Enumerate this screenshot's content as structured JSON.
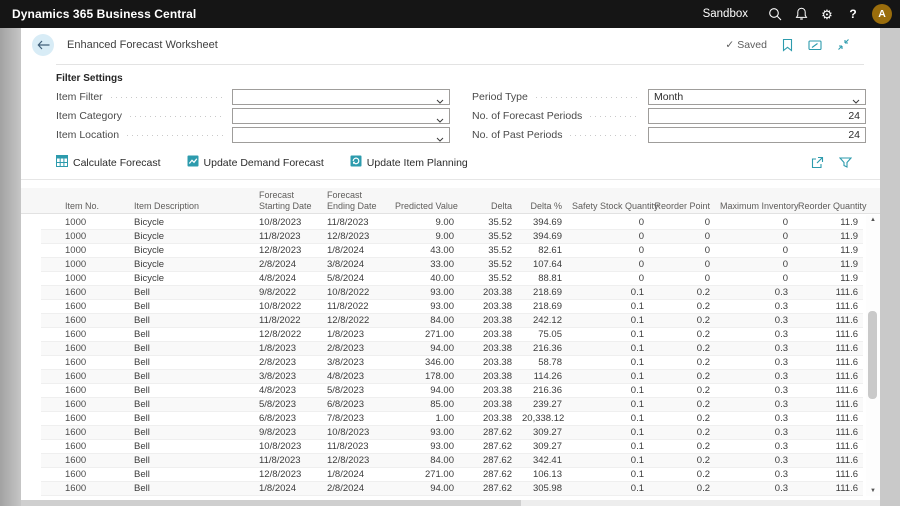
{
  "topbar": {
    "app_title": "Dynamics 365 Business Central",
    "environment": "Sandbox",
    "help_label": "?",
    "avatar_initial": "A",
    "icons": [
      "search-icon",
      "alerts-bell-icon",
      "settings-gear-icon",
      "help-icon"
    ]
  },
  "page": {
    "title": "Enhanced Forecast Worksheet",
    "saved_check": "✓",
    "saved_label": "Saved",
    "header_icons": [
      "bookmark-icon",
      "designer-icon",
      "collapse-page-icon"
    ]
  },
  "filters": {
    "section_title": "Filter Settings",
    "left": [
      {
        "label": "Item Filter",
        "value": "",
        "type": "select"
      },
      {
        "label": "Item Category",
        "value": "",
        "type": "select"
      },
      {
        "label": "Item Location",
        "value": "",
        "type": "select"
      }
    ],
    "right": [
      {
        "label": "Period Type",
        "value": "Month",
        "type": "select"
      },
      {
        "label": "No. of Forecast Periods",
        "value": "24",
        "type": "number"
      },
      {
        "label": "No. of Past Periods",
        "value": "24",
        "type": "number"
      }
    ]
  },
  "actions": {
    "buttons": [
      {
        "label": "Calculate Forecast",
        "icon": "calculate-forecast-icon"
      },
      {
        "label": "Update Demand Forecast",
        "icon": "update-demand-forecast-icon"
      },
      {
        "label": "Update Item Planning",
        "icon": "update-item-planning-icon"
      }
    ],
    "right_icons": [
      "share-icon",
      "filter-icon"
    ]
  },
  "table": {
    "columns": [
      {
        "label": "Item No.",
        "align": "left"
      },
      {
        "label": "Item Description",
        "align": "left"
      },
      {
        "label": "Forecast Starting Date",
        "align": "left"
      },
      {
        "label": "Forecast Ending Date",
        "align": "left"
      },
      {
        "label": "Predicted Value",
        "align": "right"
      },
      {
        "label": "Delta",
        "align": "right"
      },
      {
        "label": "Delta %",
        "align": "right"
      },
      {
        "label": "Safety Stock Quantity",
        "align": "right"
      },
      {
        "label": "Reorder Point",
        "align": "right"
      },
      {
        "label": "Maximum Inventory",
        "align": "right"
      },
      {
        "label": "Reorder Quantity",
        "align": "right"
      }
    ],
    "rows": [
      [
        "1000",
        "Bicycle",
        "10/8/2023",
        "11/8/2023",
        "9.00",
        "35.52",
        "394.69",
        "0",
        "0",
        "0",
        "11.9"
      ],
      [
        "1000",
        "Bicycle",
        "11/8/2023",
        "12/8/2023",
        "9.00",
        "35.52",
        "394.69",
        "0",
        "0",
        "0",
        "11.9"
      ],
      [
        "1000",
        "Bicycle",
        "12/8/2023",
        "1/8/2024",
        "43.00",
        "35.52",
        "82.61",
        "0",
        "0",
        "0",
        "11.9"
      ],
      [
        "1000",
        "Bicycle",
        "2/8/2024",
        "3/8/2024",
        "33.00",
        "35.52",
        "107.64",
        "0",
        "0",
        "0",
        "11.9"
      ],
      [
        "1000",
        "Bicycle",
        "4/8/2024",
        "5/8/2024",
        "40.00",
        "35.52",
        "88.81",
        "0",
        "0",
        "0",
        "11.9"
      ],
      [
        "1600",
        "Bell",
        "9/8/2022",
        "10/8/2022",
        "93.00",
        "203.38",
        "218.69",
        "0.1",
        "0.2",
        "0.3",
        "111.6"
      ],
      [
        "1600",
        "Bell",
        "10/8/2022",
        "11/8/2022",
        "93.00",
        "203.38",
        "218.69",
        "0.1",
        "0.2",
        "0.3",
        "111.6"
      ],
      [
        "1600",
        "Bell",
        "11/8/2022",
        "12/8/2022",
        "84.00",
        "203.38",
        "242.12",
        "0.1",
        "0.2",
        "0.3",
        "111.6"
      ],
      [
        "1600",
        "Bell",
        "12/8/2022",
        "1/8/2023",
        "271.00",
        "203.38",
        "75.05",
        "0.1",
        "0.2",
        "0.3",
        "111.6"
      ],
      [
        "1600",
        "Bell",
        "1/8/2023",
        "2/8/2023",
        "94.00",
        "203.38",
        "216.36",
        "0.1",
        "0.2",
        "0.3",
        "111.6"
      ],
      [
        "1600",
        "Bell",
        "2/8/2023",
        "3/8/2023",
        "346.00",
        "203.38",
        "58.78",
        "0.1",
        "0.2",
        "0.3",
        "111.6"
      ],
      [
        "1600",
        "Bell",
        "3/8/2023",
        "4/8/2023",
        "178.00",
        "203.38",
        "114.26",
        "0.1",
        "0.2",
        "0.3",
        "111.6"
      ],
      [
        "1600",
        "Bell",
        "4/8/2023",
        "5/8/2023",
        "94.00",
        "203.38",
        "216.36",
        "0.1",
        "0.2",
        "0.3",
        "111.6"
      ],
      [
        "1600",
        "Bell",
        "5/8/2023",
        "6/8/2023",
        "85.00",
        "203.38",
        "239.27",
        "0.1",
        "0.2",
        "0.3",
        "111.6"
      ],
      [
        "1600",
        "Bell",
        "6/8/2023",
        "7/8/2023",
        "1.00",
        "203.38",
        "20,338.12",
        "0.1",
        "0.2",
        "0.3",
        "111.6"
      ],
      [
        "1600",
        "Bell",
        "9/8/2023",
        "10/8/2023",
        "93.00",
        "287.62",
        "309.27",
        "0.1",
        "0.2",
        "0.3",
        "111.6"
      ],
      [
        "1600",
        "Bell",
        "10/8/2023",
        "11/8/2023",
        "93.00",
        "287.62",
        "309.27",
        "0.1",
        "0.2",
        "0.3",
        "111.6"
      ],
      [
        "1600",
        "Bell",
        "11/8/2023",
        "12/8/2023",
        "84.00",
        "287.62",
        "342.41",
        "0.1",
        "0.2",
        "0.3",
        "111.6"
      ],
      [
        "1600",
        "Bell",
        "12/8/2023",
        "1/8/2024",
        "271.00",
        "287.62",
        "106.13",
        "0.1",
        "0.2",
        "0.3",
        "111.6"
      ],
      [
        "1600",
        "Bell",
        "1/8/2024",
        "2/8/2024",
        "94.00",
        "287.62",
        "305.98",
        "0.1",
        "0.2",
        "0.3",
        "111.6"
      ]
    ]
  },
  "colors": {
    "topbar_bg": "#151515",
    "accent_teal": "#2d9bad",
    "avatar_bg": "#9a6d0c",
    "back_circle_bg": "#d8ecf6"
  }
}
